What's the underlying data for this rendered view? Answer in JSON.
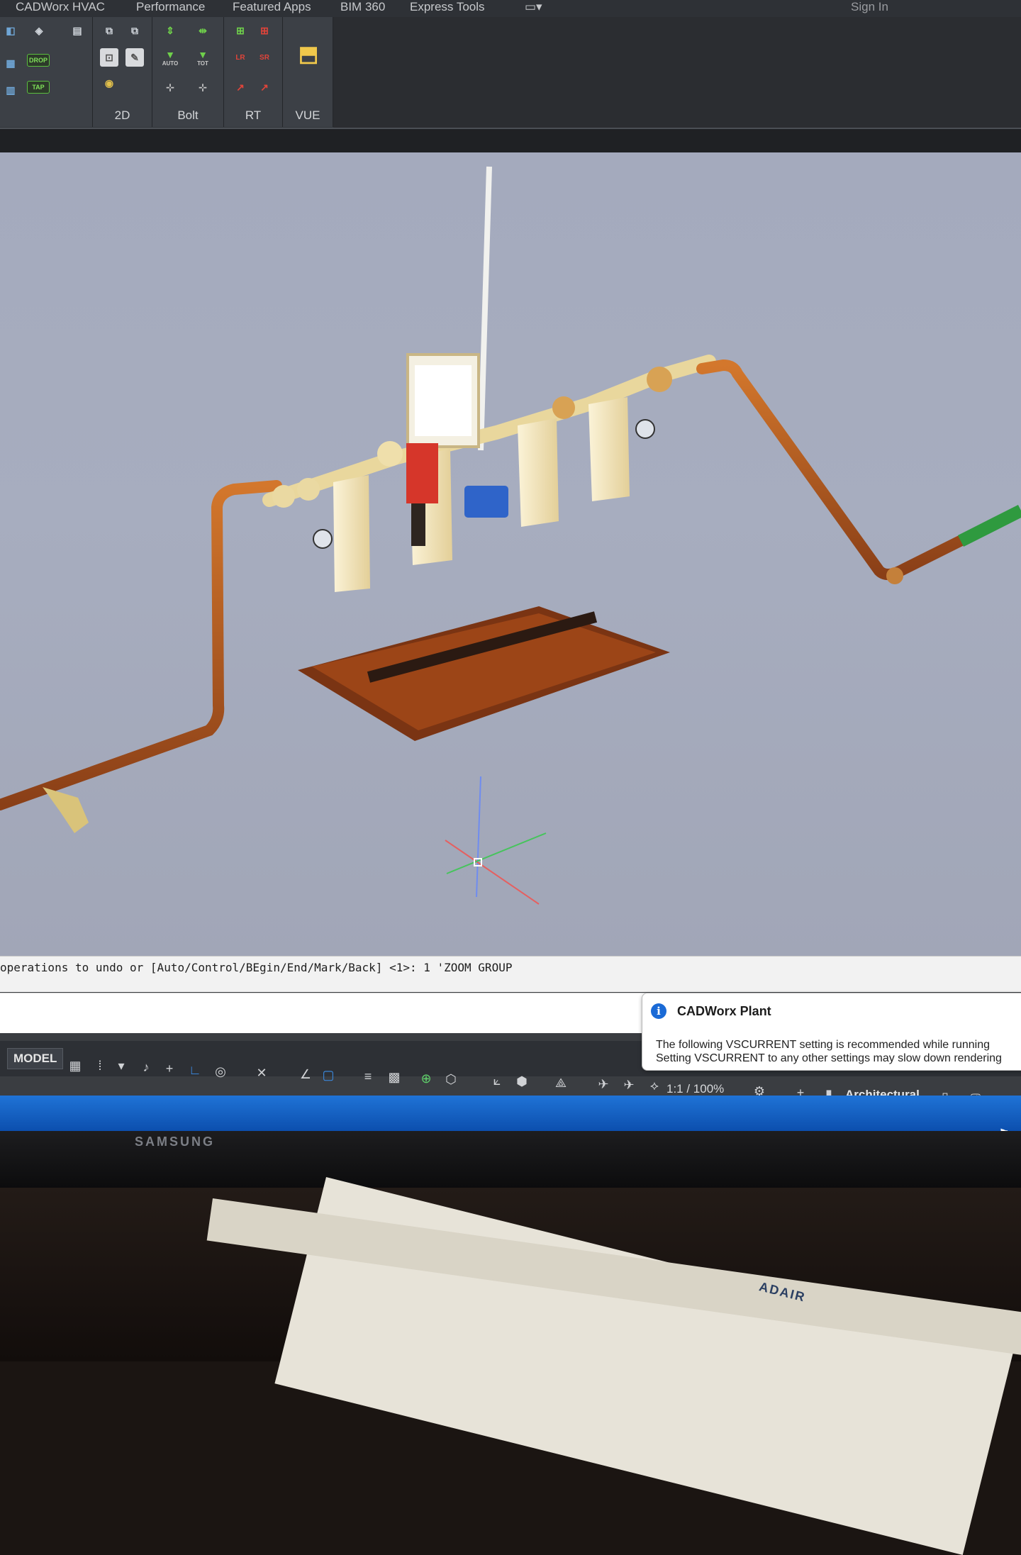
{
  "ribbon": {
    "tabs": [
      "CADWorx HVAC",
      "Performance",
      "Featured Apps",
      "BIM 360",
      "Express Tools"
    ],
    "panels": [
      {
        "title": "2D"
      },
      {
        "title": "Bolt"
      },
      {
        "title": "RT"
      },
      {
        "title": "VUE"
      }
    ],
    "button_labels": {
      "drop": "DROP",
      "tap": "TAP",
      "auto": "AUTO",
      "tot": "TOT",
      "lr": "LR",
      "sr": "SR"
    },
    "sign_in": "Sign In"
  },
  "command_line": {
    "history_text": "operations to undo or [Auto/Control/BEgin/End/Mark/Back] <1>: 1 'ZOOM GROUP"
  },
  "status_bar": {
    "model_tab": "MODEL",
    "annotation_scale": "1:1 / 100%",
    "units": "Architectural"
  },
  "notification": {
    "title": "CADWorx Plant",
    "line1": "The following VSCURRENT setting is recommended while running",
    "line2": "Setting VSCURRENT to any other settings may slow down rendering"
  },
  "monitor": {
    "brand": "SAMSUNG"
  },
  "desk_paper": {
    "logo": "ADAIR"
  },
  "colors": {
    "viewport_bg": "#a5abbd",
    "pipe_rust": "#b5581f",
    "pipe_green": "#2f9a3f",
    "accent_blue": "#1a6ad6",
    "ucs_x": "#e05555",
    "ucs_y": "#3fbf55",
    "ucs_z": "#5f7fe0"
  }
}
